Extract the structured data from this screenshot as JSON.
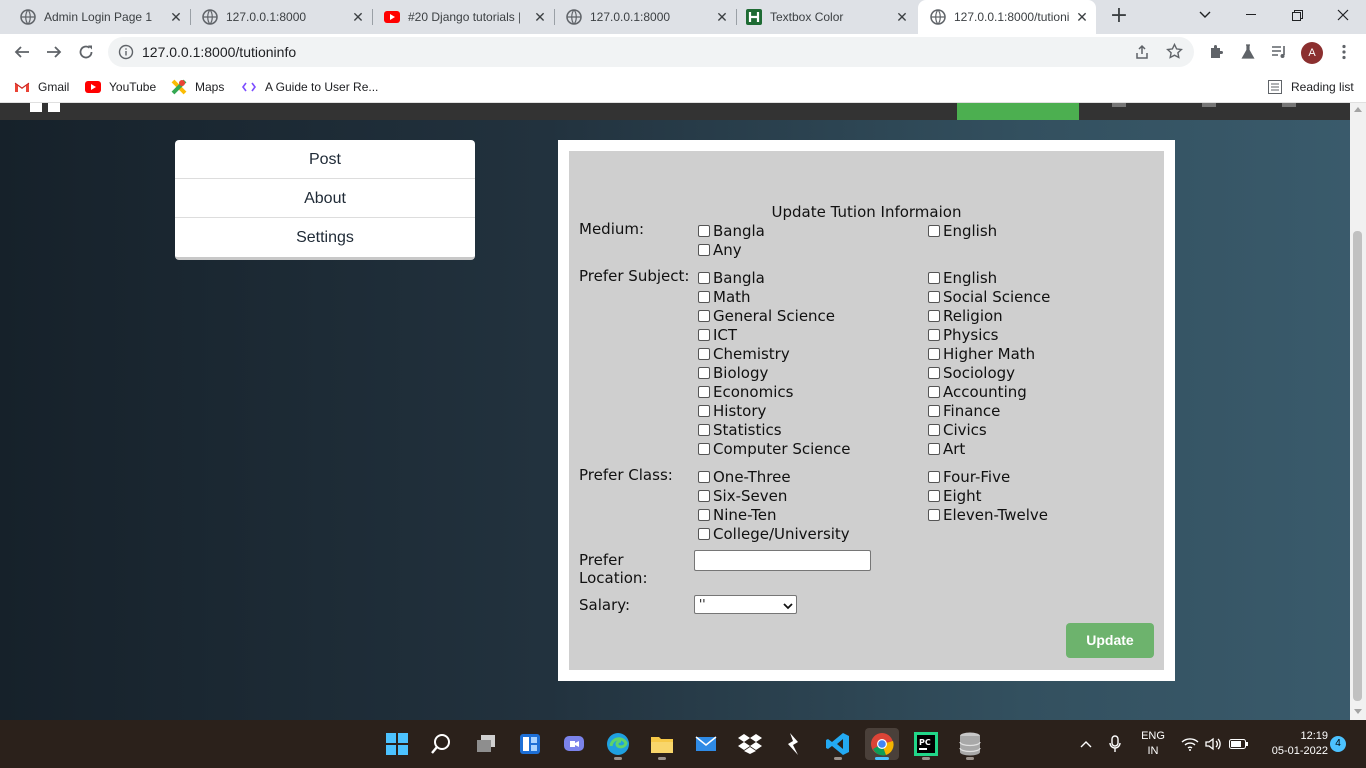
{
  "browser": {
    "tabs": [
      {
        "title": "Admin Login Page 1",
        "icon": "globe-icon"
      },
      {
        "title": "127.0.0.1:8000",
        "icon": "globe-icon"
      },
      {
        "title": "#20 Django tutorials |",
        "icon": "youtube-icon"
      },
      {
        "title": "127.0.0.1:8000",
        "icon": "globe-icon"
      },
      {
        "title": "Textbox Color",
        "icon": "h-icon"
      },
      {
        "title": "127.0.0.1:8000/tutioni",
        "icon": "globe-icon"
      }
    ],
    "active_tab": 5,
    "url": "127.0.0.1:8000/tutioninfo",
    "profile_initial": "A",
    "bookmarks": [
      {
        "label": "Gmail",
        "icon": "gmail-icon"
      },
      {
        "label": "YouTube",
        "icon": "youtube-icon"
      },
      {
        "label": "Maps",
        "icon": "maps-icon"
      },
      {
        "label": "A Guide to User Re...",
        "icon": "code-icon"
      }
    ],
    "reading_list": "Reading list"
  },
  "sidebar": {
    "items": [
      {
        "label": "Post"
      },
      {
        "label": "About"
      },
      {
        "label": "Settings"
      }
    ]
  },
  "form": {
    "title": "Update Tution Informaion",
    "medium_label": "Medium:",
    "medium_options": [
      "Bangla",
      "English",
      "Any"
    ],
    "subject_label": "Prefer Subject:",
    "subjects_left": [
      "Bangla",
      "Math",
      "General Science",
      "ICT",
      "Chemistry",
      "Biology",
      "Economics",
      "History",
      "Statistics",
      "Computer Science"
    ],
    "subjects_right": [
      "English",
      "Social Science",
      "Religion",
      "Physics",
      "Higher Math",
      "Sociology",
      "Accounting",
      "Finance",
      "Civics",
      "Art"
    ],
    "class_label": "Prefer Class:",
    "classes_left": [
      "One-Three",
      "Six-Seven",
      "Nine-Ten",
      "College/University"
    ],
    "classes_right": [
      "Four-Five",
      "Eight",
      "Eleven-Twelve"
    ],
    "location_label_1": "Prefer",
    "location_label_2": "Location:",
    "location_value": "",
    "salary_label": "Salary:",
    "salary_value": "''",
    "submit_label": "Update"
  },
  "taskbar": {
    "lang_1": "ENG",
    "lang_2": "IN",
    "time": "12:19",
    "date": "05-01-2022",
    "notifications": "4"
  },
  "colors": {
    "accent_green": "#4caf50",
    "button_green": "#6db36d",
    "form_bg": "#cfcfcf"
  }
}
